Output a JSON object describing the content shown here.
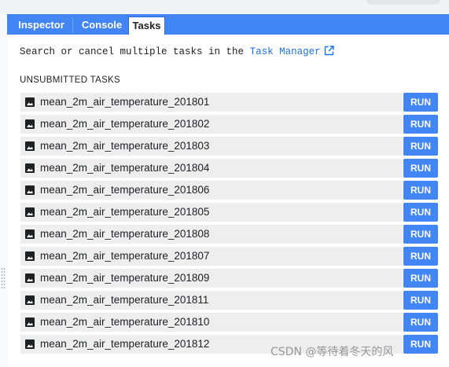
{
  "tabs": [
    "Inspector",
    "Console",
    "Tasks"
  ],
  "active_tab": "Tasks",
  "description": {
    "text": "Search or cancel multiple tasks in the",
    "link_text": "Task Manager",
    "link_icon": "external-link-icon"
  },
  "section_title": "UNSUBMITTED TASKS",
  "task_icon": "image-icon",
  "run_label": "RUN",
  "tasks": [
    "mean_2m_air_temperature_201801",
    "mean_2m_air_temperature_201802",
    "mean_2m_air_temperature_201803",
    "mean_2m_air_temperature_201804",
    "mean_2m_air_temperature_201806",
    "mean_2m_air_temperature_201805",
    "mean_2m_air_temperature_201808",
    "mean_2m_air_temperature_201807",
    "mean_2m_air_temperature_201809",
    "mean_2m_air_temperature_201811",
    "mean_2m_air_temperature_201810",
    "mean_2m_air_temperature_201812"
  ],
  "watermark": "CSDN @等待着冬天的风",
  "colors": {
    "tab_bar": "#4285f4",
    "run_button": "#4285f4",
    "link": "#1a73e8",
    "row_background": "#eeeeee"
  }
}
